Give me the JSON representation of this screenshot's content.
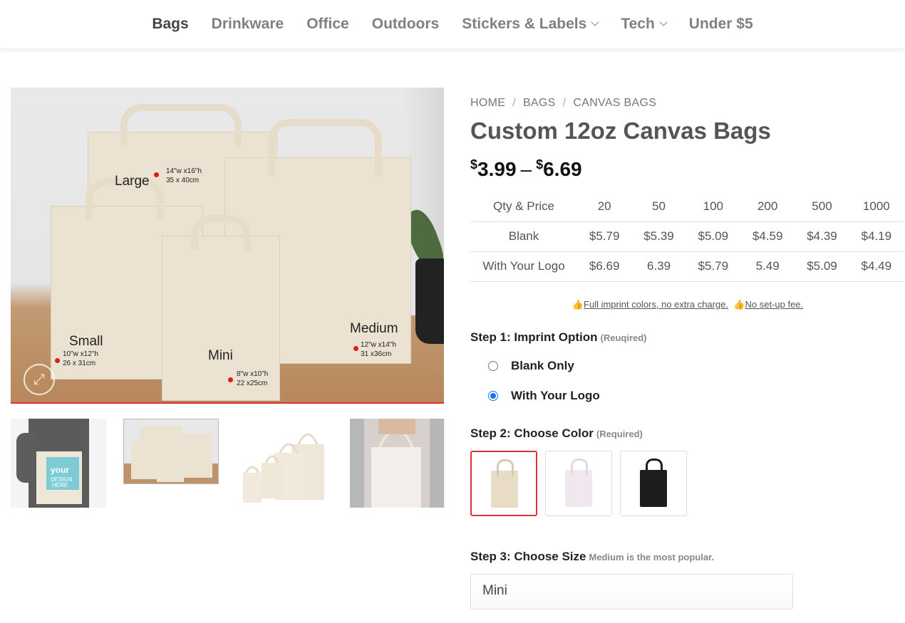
{
  "nav": {
    "items": [
      {
        "label": "Bags"
      },
      {
        "label": "Drinkware"
      },
      {
        "label": "Office"
      },
      {
        "label": "Outdoors"
      },
      {
        "label": "Stickers & Labels"
      },
      {
        "label": "Tech"
      },
      {
        "label": "Under $5"
      }
    ]
  },
  "gallery": {
    "labels": {
      "large": "Large",
      "large_dim1": "14\"w x16\"h",
      "large_dim2": "35 x 40cm",
      "small": "Small",
      "small_dim1": "10\"w x12\"h",
      "small_dim2": "26 x 31cm",
      "mini": "Mini",
      "mini_dim1": "8\"w x10\"h",
      "mini_dim2": "22 x25cm",
      "medium": "Medium",
      "medium_dim1": "12\"w x14\"h",
      "medium_dim2": "31 x36cm"
    },
    "thumb1_text": "your DESIGN HERE"
  },
  "breadcrumb": {
    "home": "HOME",
    "bags": "BAGS",
    "current": "CANVAS BAGS",
    "separator": "/"
  },
  "product": {
    "title": "Custom 12oz Canvas Bags",
    "currency": "$",
    "price_min": "3.99",
    "price_sep": "–",
    "price_max": "6.69"
  },
  "qty_table": {
    "header": [
      "Qty & Price",
      "20",
      "50",
      "100",
      "200",
      "500",
      "1000"
    ],
    "rows": [
      [
        "Blank",
        "$5.79",
        "$5.39",
        "$5.09",
        "$4.59",
        "$4.39",
        "$4.19"
      ],
      [
        "With Your Logo",
        "$6.69",
        "6.39",
        "$5.79",
        "5.49",
        "$5.09",
        "$4.49"
      ]
    ]
  },
  "note": {
    "icon1": "👍",
    "text1": "Full imprint colors, no extra charge.",
    "icon2": "👍",
    "text2": "No set-up fee."
  },
  "step1": {
    "label": "Step 1: Imprint Option",
    "hint": "(Reuqired)",
    "options": [
      "Blank Only",
      "With Your Logo"
    ],
    "selected": "With Your Logo"
  },
  "step2": {
    "label": "Step 2: Choose Color",
    "hint": "(Required)",
    "colors": [
      "#e8dcc6",
      "#f1e8ef",
      "#1d1d1f"
    ]
  },
  "step3": {
    "label": "Step 3: Choose Size",
    "hint": "Medium is the most popular.",
    "value": "Mini"
  }
}
